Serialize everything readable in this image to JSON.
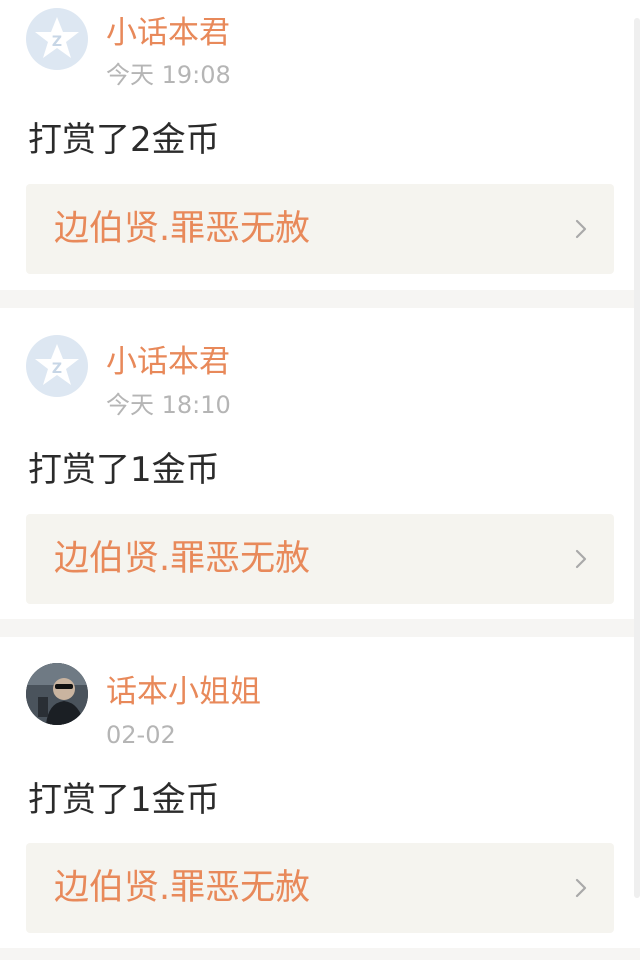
{
  "colors": {
    "accent": "#e8895a",
    "meta_text": "#b5b5b5",
    "body_text": "#2b2b2b",
    "link_box_bg": "#f5f4ef",
    "separator": "#f6f5f3",
    "default_avatar_bg": "#dde7f2"
  },
  "items": [
    {
      "user": "小话本君",
      "time": "今天 19:08",
      "message": "打赏了2金币",
      "link_text": "边伯贤.罪恶无赦",
      "avatar": "default-star-avatar-icon"
    },
    {
      "user": "小话本君",
      "time": "今天 18:10",
      "message": "打赏了1金币",
      "link_text": "边伯贤.罪恶无赦",
      "avatar": "default-star-avatar-icon"
    },
    {
      "user": "话本小姐姐",
      "time": "02-02",
      "message": "打赏了1金币",
      "link_text": "边伯贤.罪恶无赦",
      "avatar": "user-photo-avatar"
    }
  ]
}
